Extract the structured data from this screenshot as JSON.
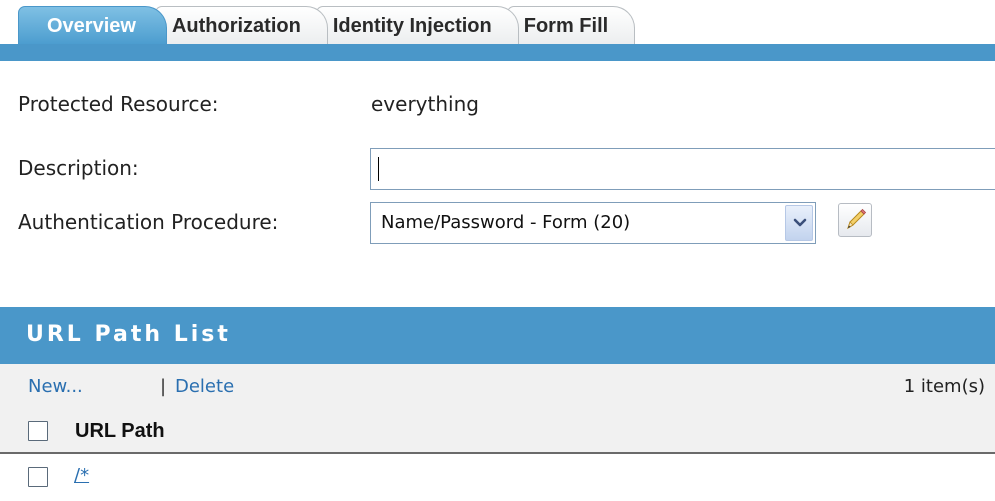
{
  "tabs": [
    {
      "label": "Overview",
      "active": true
    },
    {
      "label": "Authorization",
      "active": false
    },
    {
      "label": "Identity Injection",
      "active": false
    },
    {
      "label": "Form Fill",
      "active": false
    }
  ],
  "form": {
    "protected_resource_label": "Protected Resource:",
    "protected_resource_value": "everything",
    "description_label": "Description:",
    "description_value": "",
    "auth_procedure_label": "Authentication Procedure:",
    "auth_procedure_value": "Name/Password - Form (20)"
  },
  "url_path_list": {
    "title": "URL Path List",
    "new_label": "New...",
    "separator": "|",
    "delete_label": "Delete",
    "item_count": "1 item(s)",
    "column_header": "URL Path",
    "rows": [
      {
        "path": "/*"
      }
    ]
  },
  "colors": {
    "accent": "#4a97c9",
    "link": "#2a6fb0",
    "toolbar_bg": "#f1f1f1"
  },
  "icons": {
    "dropdown": "chevron-down-icon",
    "edit": "pencil-icon"
  }
}
